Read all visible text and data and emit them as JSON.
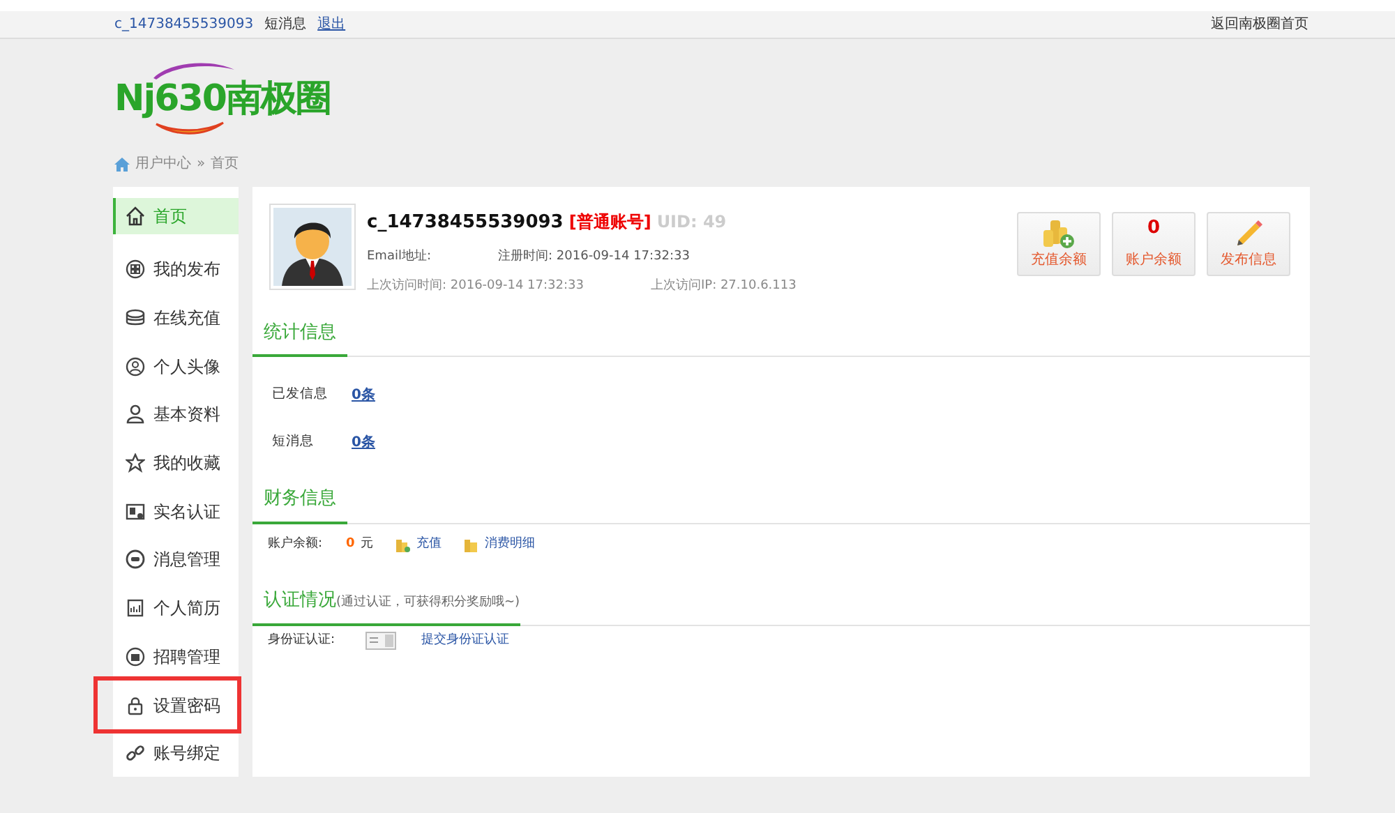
{
  "top_bar": {
    "username": "c_14738455539093",
    "messages": "短消息",
    "logout": "退出",
    "home_link": "返回南极圈首页"
  },
  "logo": {
    "text": "Nj630南极圈"
  },
  "breadcrumb": [
    {
      "label": "用户中心"
    },
    {
      "label": "首页"
    }
  ],
  "breadcrumb_separator": "»",
  "sidebar": {
    "items": [
      {
        "label": "首页",
        "kind": "home",
        "selected": true,
        "highlighted": false
      },
      {
        "label": "我的发布",
        "kind": "grid",
        "selected": false,
        "highlighted": false
      },
      {
        "label": "在线充值",
        "kind": "coins",
        "selected": false,
        "highlighted": false
      },
      {
        "label": "个人头像",
        "kind": "avatar",
        "selected": false,
        "highlighted": false
      },
      {
        "label": "基本资料",
        "kind": "user",
        "selected": false,
        "highlighted": false
      },
      {
        "label": "我的收藏",
        "kind": "star",
        "selected": false,
        "highlighted": false
      },
      {
        "label": "实名认证",
        "kind": "idcard",
        "selected": false,
        "highlighted": false
      },
      {
        "label": "消息管理",
        "kind": "chat",
        "selected": false,
        "highlighted": false
      },
      {
        "label": "个人简历",
        "kind": "resume",
        "selected": false,
        "highlighted": false
      },
      {
        "label": "招聘管理",
        "kind": "briefcase",
        "selected": false,
        "highlighted": false
      },
      {
        "label": "设置密码",
        "kind": "lock",
        "selected": false,
        "highlighted": true
      },
      {
        "label": "账号绑定",
        "kind": "link",
        "selected": false,
        "highlighted": false
      }
    ]
  },
  "profile": {
    "name": "c_14738455539093",
    "account_type": "[普通账号]",
    "uid": "UID: 49",
    "email_label": "Email地址:",
    "registered": "注册时间: 2016-09-14 17:32:33",
    "last_visit": "上次访问时间: 2016-09-14 17:32:33",
    "last_ip": "上次访问IP: 27.10.6.113"
  },
  "quick_buttons": [
    {
      "kind": "coins",
      "label": "充值余额"
    },
    {
      "kind": "number",
      "value": "0",
      "label": "账户余额"
    },
    {
      "kind": "pencil",
      "label": "发布信息"
    }
  ],
  "stats": {
    "title": "统计信息",
    "rows": [
      {
        "label": "已发信息",
        "value": "0条"
      },
      {
        "label": "短消息",
        "value": "0条"
      }
    ]
  },
  "finance": {
    "title": "财务信息",
    "balance_label": "账户余额:",
    "balance_amount": "0",
    "balance_unit": "元",
    "recharge": "充值",
    "details": "消费明细"
  },
  "verification": {
    "title": "认证情况",
    "note": "(通过认证，可获得积分奖励哦~)",
    "id_label": "身份证认证:",
    "submit": "提交身份证认证"
  }
}
